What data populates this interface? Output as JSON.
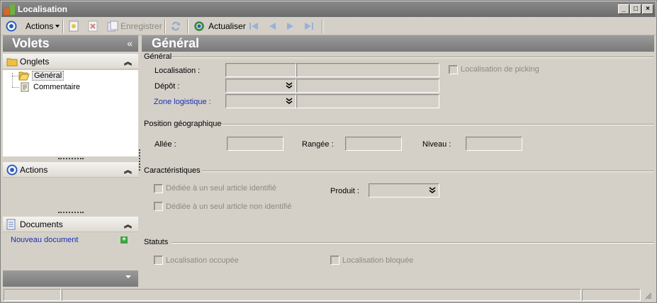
{
  "window": {
    "title": "Localisation"
  },
  "toolbar": {
    "actions_label": "Actions",
    "save_label": "Enregistrer",
    "refresh_label": "Actualiser"
  },
  "left_pane": {
    "title": "Volets",
    "collapse_glyph": "«",
    "onglets": {
      "title": "Onglets",
      "items": [
        {
          "label": "Général",
          "selected": true,
          "icon": "open-folder-icon"
        },
        {
          "label": "Commentaire",
          "selected": false,
          "icon": "document-icon"
        }
      ]
    },
    "actions": {
      "title": "Actions"
    },
    "documents": {
      "title": "Documents",
      "new_document_label": "Nouveau document"
    }
  },
  "form": {
    "header_title": "Général",
    "general_group": {
      "title": "Général",
      "localisation_label": "Localisation :",
      "depot_label": "Dépôt :",
      "zone_label": "Zone logistique :",
      "picking_label": "Localisation de picking"
    },
    "position_group": {
      "title": "Position géographique",
      "allee_label": "Allée :",
      "rangee_label": "Rangée :",
      "niveau_label": "Niveau :"
    },
    "caracteristiques_group": {
      "title": "Caractéristiques",
      "article_identifie_label": "Dédiée à un seul article identifié",
      "article_non_identifie_label": "Dédiée à un seul article non identifié",
      "produit_label": "Produit :"
    },
    "statuts_group": {
      "title": "Statuts",
      "occupee_label": "Localisation occupée",
      "bloquee_label": "Localisation bloquée"
    }
  },
  "colors": {
    "header_gray": "#7a7a7a",
    "link_blue": "#1a2fb0",
    "window_bg": "#d4d0c8"
  }
}
